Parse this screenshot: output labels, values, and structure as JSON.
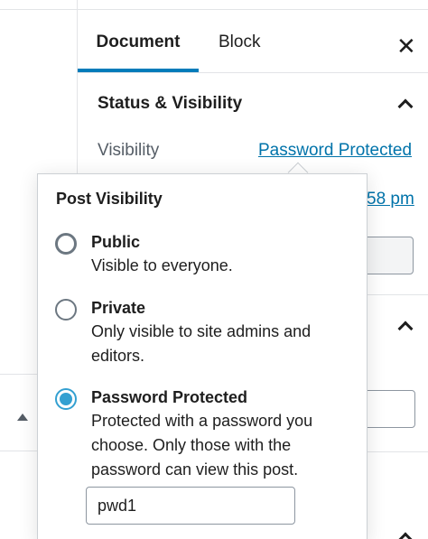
{
  "tabs": {
    "document": "Document",
    "block": "Block",
    "close": "✕"
  },
  "status_visibility": {
    "title": "Status & Visibility",
    "visibility_label": "Visibility",
    "visibility_value": "Password Protected",
    "publish_time_partial": "58 pm"
  },
  "popover": {
    "title": "Post Visibility",
    "options": [
      {
        "label": "Public",
        "description": "Visible to everyone.",
        "selected": false
      },
      {
        "label": "Private",
        "description": "Only visible to site admins and editors.",
        "selected": false
      },
      {
        "label": "Password Protected",
        "description": "Protected with a password you choose. Only those with the password can view this post.",
        "selected": true
      }
    ],
    "password_value": "pwd1"
  },
  "colors": {
    "accent": "#007cba",
    "link": "#0073aa",
    "radio_selected": "#33a0d1"
  }
}
